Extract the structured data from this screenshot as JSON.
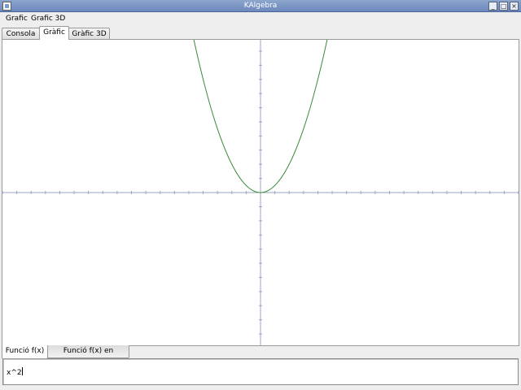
{
  "window": {
    "title": "KAlgebra",
    "buttons": [
      "_",
      "□",
      "×"
    ]
  },
  "menubar": {
    "items": [
      {
        "label": "Grafic"
      },
      {
        "label": "Grafic 3D"
      }
    ]
  },
  "main_tabs": [
    {
      "label": "Consola",
      "active": false
    },
    {
      "label": "Gràfic",
      "active": true
    },
    {
      "label": "Gràfic 3D",
      "active": false
    }
  ],
  "plot": {
    "function": "y = x^2",
    "curve_color": "#3a8a3a",
    "axis_color": "#9aa6c4",
    "background": "#ffffff",
    "x_range": [
      -9,
      9
    ],
    "y_range": [
      -5.4,
      5.4
    ],
    "tick_step": 0.5
  },
  "bottom_tabs": [
    {
      "label": "Funció f(x)",
      "active": true
    },
    {
      "label": "Funció f(x) en MathML",
      "active": false
    }
  ],
  "editor": {
    "value": "x^2"
  }
}
